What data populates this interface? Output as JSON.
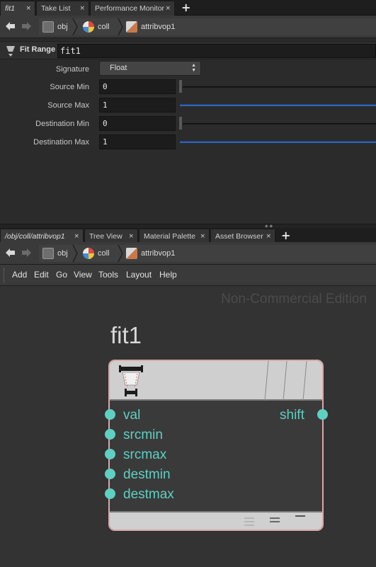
{
  "top_tabs": [
    {
      "label": "fit1",
      "active": true
    },
    {
      "label": "Take List",
      "active": false
    },
    {
      "label": "Performance Monitor",
      "active": false
    }
  ],
  "close_glyph": "×",
  "plus_glyph": "+",
  "path": {
    "crumbs": [
      "obj",
      "coll",
      "attribvop1"
    ]
  },
  "params": {
    "node_type_label": "Fit Range",
    "node_name": "fit1",
    "signature_label": "Signature",
    "signature_value": "Float",
    "rows": [
      {
        "label": "Source Min",
        "value": "0"
      },
      {
        "label": "Source Max",
        "value": "1"
      },
      {
        "label": "Destination Min",
        "value": "0"
      },
      {
        "label": "Destination Max",
        "value": "1"
      }
    ]
  },
  "bottom_tabs": [
    {
      "label": "/obj/coll/attribvop1",
      "active": true
    },
    {
      "label": "Tree View",
      "active": false
    },
    {
      "label": "Material Palette",
      "active": false
    },
    {
      "label": "Asset Browser",
      "active": false
    }
  ],
  "menu": [
    "Add",
    "Edit",
    "Go",
    "View",
    "Tools",
    "Layout",
    "Help"
  ],
  "network": {
    "watermark": "Non-Commercial Edition",
    "node_title": "fit1",
    "inputs": [
      "val",
      "srcmin",
      "srcmax",
      "destmin",
      "destmax"
    ],
    "outputs": [
      "shift"
    ]
  },
  "colors": {
    "port": "#5ed0c2",
    "node_outline": "#d6a8a8",
    "slider_blue": "#2f66b8"
  },
  "icons": {
    "back": "arrow-left-icon",
    "forward": "arrow-right-icon",
    "obj": "obj-context-icon",
    "coll": "geometry-object-icon",
    "vop": "attribvop-icon",
    "fit": "fit-range-icon"
  }
}
